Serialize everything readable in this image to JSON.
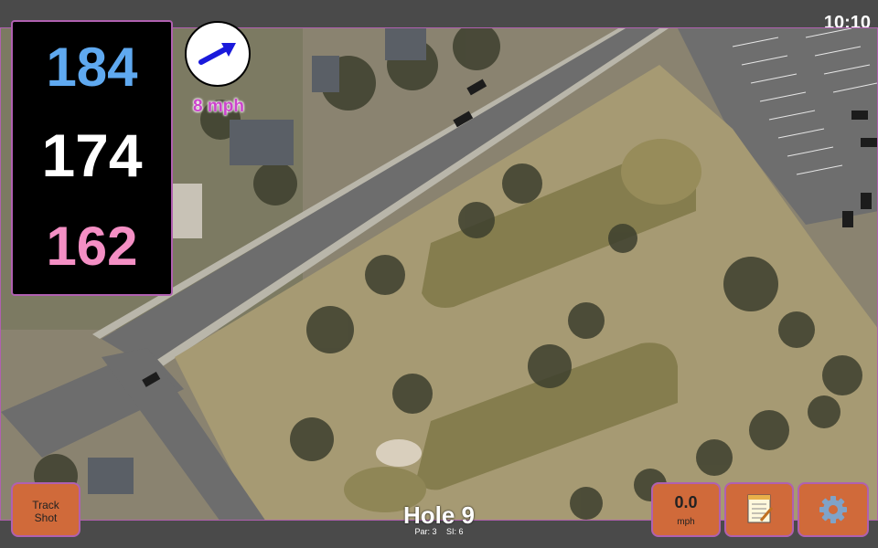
{
  "status": {
    "time": "10:10"
  },
  "yardages": {
    "back": "184",
    "middle": "174",
    "front": "162"
  },
  "wind": {
    "speed_label": "8 mph",
    "icon": "wind-direction-arrow-icon"
  },
  "buttons": {
    "track_shot_line1": "Track",
    "track_shot_line2": "Shot",
    "speed_value": "0.0",
    "speed_unit": "mph",
    "notes_icon": "notepad-icon",
    "settings_icon": "gear-icon"
  },
  "hole": {
    "title": "Hole 9",
    "par": "Par: 3",
    "si": "SI: 6"
  },
  "colors": {
    "back": "#5fa9f0",
    "middle": "#ffffff",
    "front": "#f48fc4",
    "accent": "#b060b0",
    "button": "#d06a3a"
  }
}
